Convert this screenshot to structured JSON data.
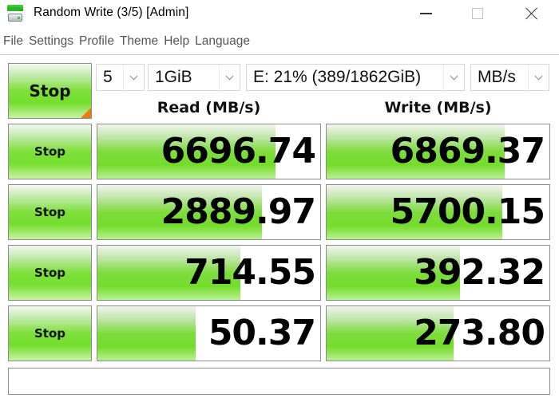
{
  "window": {
    "title": "Random Write (3/5) [Admin]",
    "icon": "disk-mark-app-icon",
    "controls": {
      "minimize": "minimize-icon",
      "maximize": "maximize-icon",
      "close": "close-icon"
    }
  },
  "menu": {
    "items": [
      "File",
      "Settings",
      "Profile",
      "Theme",
      "Help",
      "Language"
    ]
  },
  "toolbar": {
    "main_button_label": "Stop",
    "count": "5",
    "size": "1GiB",
    "drive": "E: 21% (389/1862GiB)",
    "unit": "MB/s"
  },
  "columns": {
    "read_header": "Read (MB/s)",
    "write_header": "Write (MB/s)"
  },
  "rows": [
    {
      "button_label": "Stop",
      "read": "6696.74",
      "write": "6869.37",
      "read_fill": 0.8,
      "write_fill": 0.8
    },
    {
      "button_label": "Stop",
      "read": "2889.97",
      "write": "5700.15",
      "read_fill": 0.74,
      "write_fill": 0.79
    },
    {
      "button_label": "Stop",
      "read": "714.55",
      "write": "392.32",
      "read_fill": 0.64,
      "write_fill": 0.6
    },
    {
      "button_label": "Stop",
      "read": "50.37",
      "write": "273.80",
      "read_fill": 0.44,
      "write_fill": 0.57
    }
  ],
  "comment": "",
  "colors": {
    "accent_green": "#7edc3e",
    "corner_orange": "#f07a12"
  }
}
